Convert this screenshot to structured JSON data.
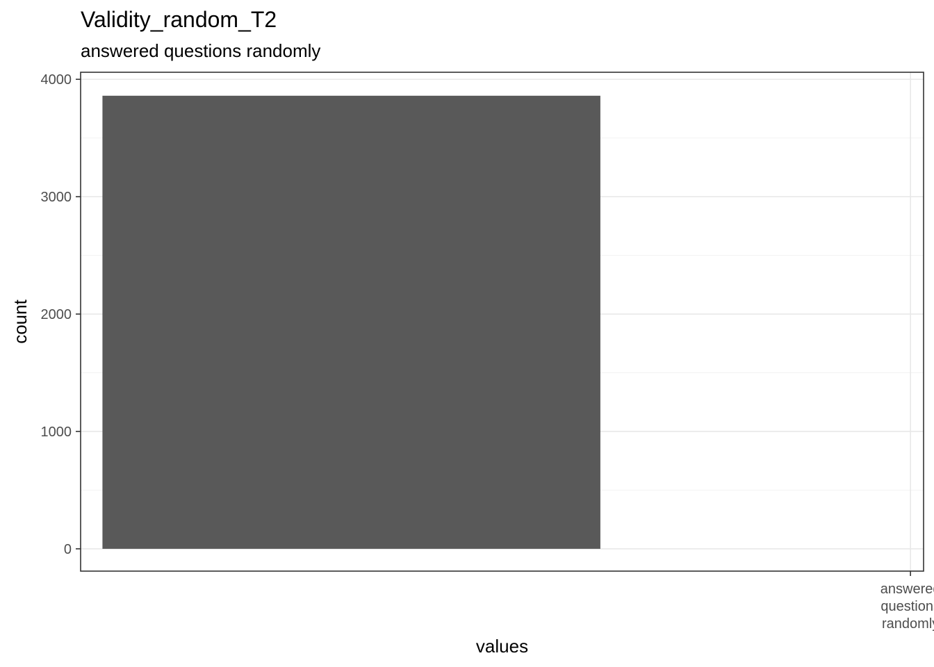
{
  "chart_data": {
    "type": "bar",
    "title": "Validity_random_T2",
    "subtitle": "answered questions randomly",
    "xlabel": "values",
    "ylabel": "count",
    "x_tick_labels": [
      {
        "value": 1,
        "label": "answered\nquestions\nrandomly"
      }
    ],
    "x_range": [
      -0.9,
      1.03
    ],
    "ylim": [
      -190,
      4060
    ],
    "y_ticks": [
      0,
      1000,
      2000,
      3000,
      4000
    ],
    "y_minor_ticks": [
      500,
      1500,
      2500,
      3500
    ],
    "bars": [
      {
        "x_start": -0.85,
        "x_end": 0.29,
        "value": 3860
      }
    ],
    "bar_color": "#595959",
    "grid": true,
    "legend": "none"
  }
}
